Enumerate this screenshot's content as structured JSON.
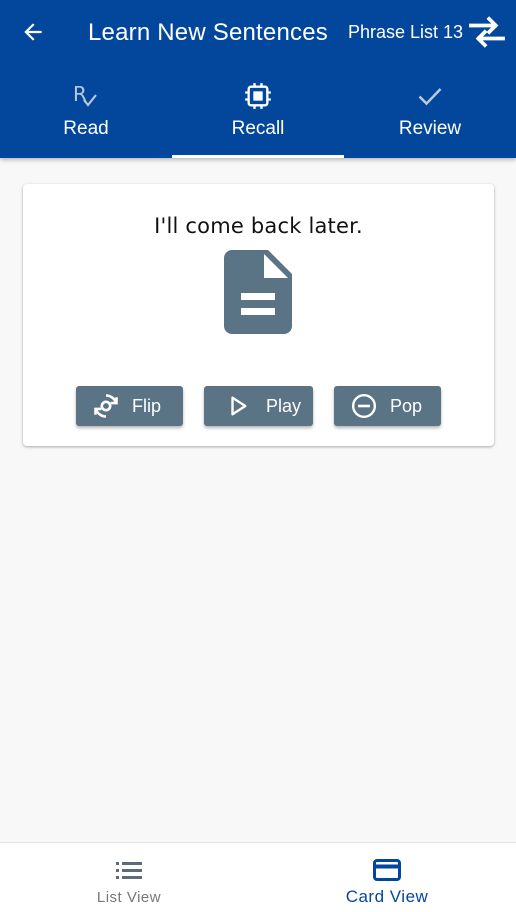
{
  "header": {
    "title": "Learn New Sentences",
    "list_name": "Phrase List 13",
    "back_icon": "arrow-left-icon",
    "swap_icon": "swap-horizontal-icon"
  },
  "tabs": [
    {
      "label": "Read",
      "icon": "prescription-check-icon",
      "active": false
    },
    {
      "label": "Recall",
      "icon": "chip-icon",
      "active": true
    },
    {
      "label": "Review",
      "icon": "check-icon",
      "active": false
    }
  ],
  "card": {
    "sentence": "I'll come back later.",
    "icon": "document-icon",
    "buttons": [
      {
        "label": "Flip",
        "icon": "rotate-camera-icon"
      },
      {
        "label": "Play",
        "icon": "play-icon"
      },
      {
        "label": "Pop",
        "icon": "minus-circle-icon"
      }
    ]
  },
  "bottom_nav": [
    {
      "label": "List View",
      "icon": "list-icon",
      "active": false
    },
    {
      "label": "Card View",
      "icon": "credit-card-icon",
      "active": true
    }
  ],
  "colors": {
    "primary": "#02479c",
    "button": "#5a7485",
    "background": "#f8f8f8"
  }
}
